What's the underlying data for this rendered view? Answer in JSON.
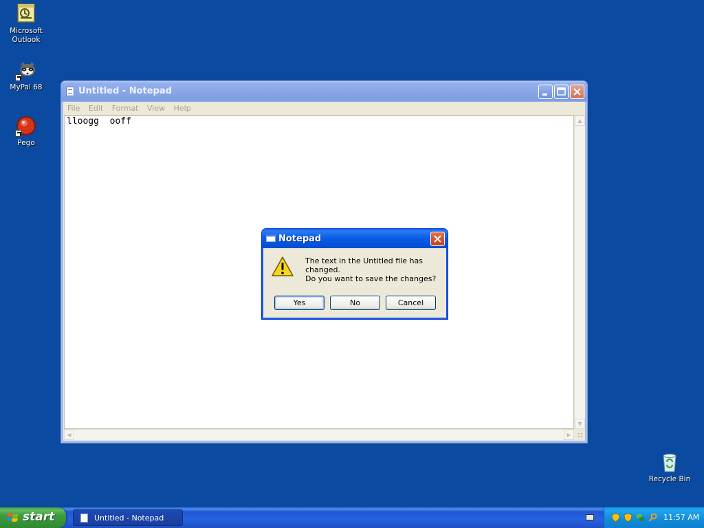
{
  "desktop": {
    "icons": [
      {
        "label_line1": "Microsoft",
        "label_line2": "Outlook",
        "icon": "outlook-icon"
      },
      {
        "label": "MyPal 68",
        "icon": "mypal-icon"
      },
      {
        "label": "Pego",
        "icon": "pego-icon"
      }
    ],
    "recycle_bin": {
      "label": "Recycle Bin",
      "icon": "recycle-bin-icon"
    }
  },
  "notepad": {
    "title": "Untitled - Notepad",
    "menu": [
      "File",
      "Edit",
      "Format",
      "View",
      "Help"
    ],
    "content": "lloogg  ooff",
    "buttons": {
      "minimize": "minimize-icon",
      "maximize": "maximize-icon",
      "close": "close-icon"
    }
  },
  "dialog": {
    "title": "Notepad",
    "message_line1": "The text in the Untitled file has changed.",
    "message_line2": "Do you want to save the changes?",
    "buttons": {
      "yes": "Yes",
      "no": "No",
      "cancel": "Cancel"
    },
    "icon": "warning-icon"
  },
  "taskbar": {
    "start_label": "start",
    "task_label": "Untitled - Notepad",
    "clock": "11:57 AM",
    "tray_icons": [
      "shield-icon",
      "shield-icon",
      "network-icon",
      "search-icon"
    ]
  },
  "colors": {
    "desktop_bg": "#0a4aa0",
    "taskbar_blue": "#2157d7",
    "start_green": "#3d9b3d",
    "tray_blue": "#108ad8"
  }
}
